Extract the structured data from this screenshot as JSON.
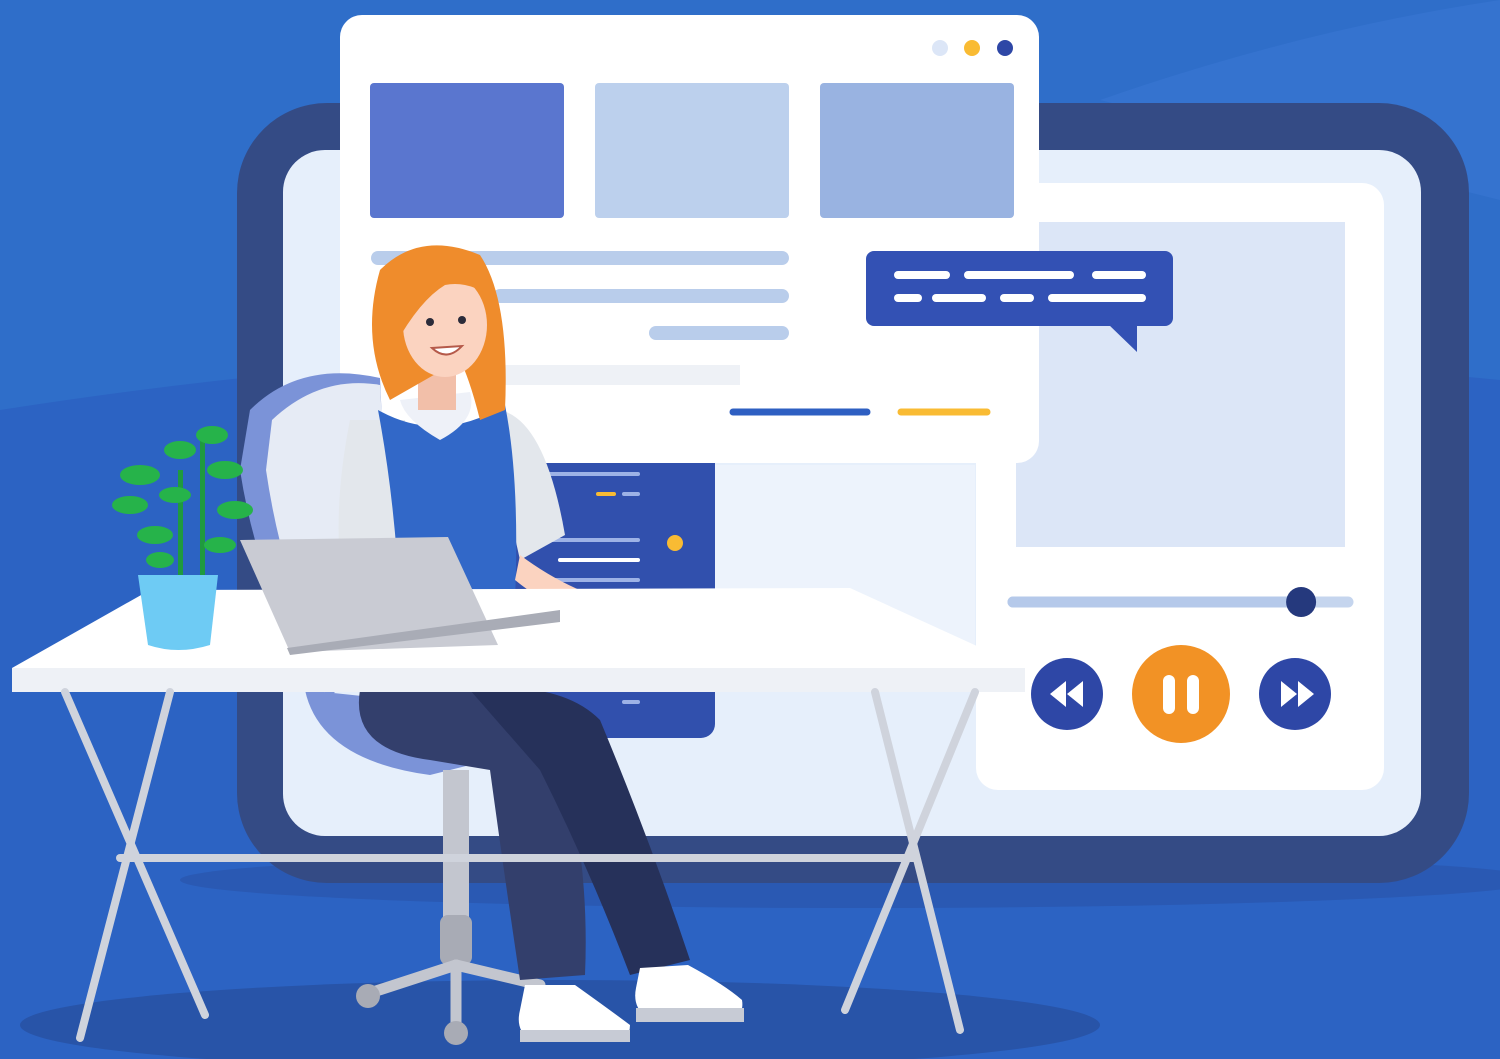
{
  "palette": {
    "background": "#2f6ec9",
    "background_dark": "#2858b8",
    "tablet_frame": "#344b85",
    "tablet_screen": "#e6effb",
    "browser_window": "#ffffff",
    "card_1": "#5a76cf",
    "card_2": "#bcd0ed",
    "card_3": "#99b3e1",
    "text_line": "#b9cdeb",
    "chat_bubble": "#3351b4",
    "code_panel": "#3150ad",
    "accent_orange": "#f29225",
    "accent_yellow": "#f9bb33",
    "player_button": "#2e47a6",
    "progress_track": "#c5d5ee",
    "progress_knob": "#25397d",
    "desk": "#ffffff",
    "desk_legs": "#cfd3dc",
    "laptop": "#c9cbd3",
    "plant_pot": "#6ecbf4",
    "plant_leaves": "#26b34a",
    "hair": "#ef8c2c",
    "skin": "#fbd3c0",
    "vest": "#3268c8",
    "pants": "#333f6c",
    "chair": "#e6ebf5",
    "chair_back": "#7b93d8"
  },
  "icons": [
    "window-dots-icon",
    "chat-bubble-icon",
    "rewind-icon",
    "pause-icon",
    "fast-forward-icon"
  ],
  "media_player": {
    "progress": 0.86
  }
}
